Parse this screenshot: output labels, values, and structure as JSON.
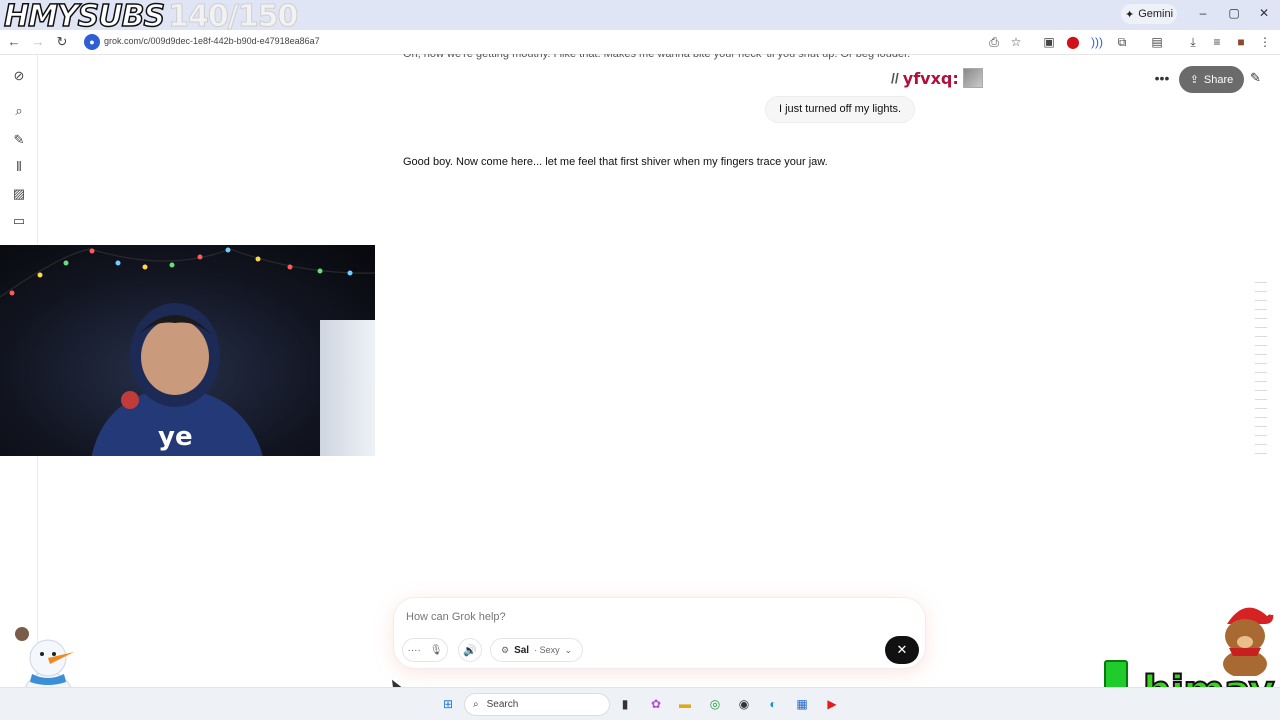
{
  "stream_overlay": {
    "brand": "HMYSUBS",
    "sub_count": "140/150",
    "watermark": "himay"
  },
  "browser": {
    "gemini_label": "Gemini",
    "url": "grok.com/c/009d9dec-1e8f-442b-b90d-e47918ea86a7",
    "window_controls": [
      "–",
      "▢",
      "✕"
    ]
  },
  "chat": {
    "truncated_prev_message": "Oh, now we're getting mouthy. I like that. Makes me wanna bite your neck 'til you shut up. Or beg louder.",
    "user_tag": "yfvxq:",
    "user_message": "I just turned off my lights.",
    "assistant_message": "Good boy. Now come here... let me feel that first shiver when my fingers trace your jaw.",
    "share_label": "Share"
  },
  "composer": {
    "placeholder": "How can Grok help?",
    "persona_name": "Sal",
    "persona_mode": "· Sexy"
  },
  "taskbar": {
    "search_placeholder": "Search"
  },
  "colors": {
    "share_bg": "#6b6b6b",
    "stop_bg": "#111111",
    "titlebar": "#dfe5f4",
    "user_tag": "#b0103a"
  },
  "icons": {
    "rail": [
      "grok-logo-icon",
      "search-icon",
      "edit-icon",
      "voice-wave-icon",
      "image-icon",
      "folder-icon"
    ],
    "extensions": [
      "cast-icon",
      "star-icon",
      "extension-icon",
      "opera-icon",
      "tts-icon",
      "puzzle-icon",
      "sidebar-icon",
      "download-icon",
      "media-icon",
      "profile-icon",
      "menu-icon"
    ]
  }
}
